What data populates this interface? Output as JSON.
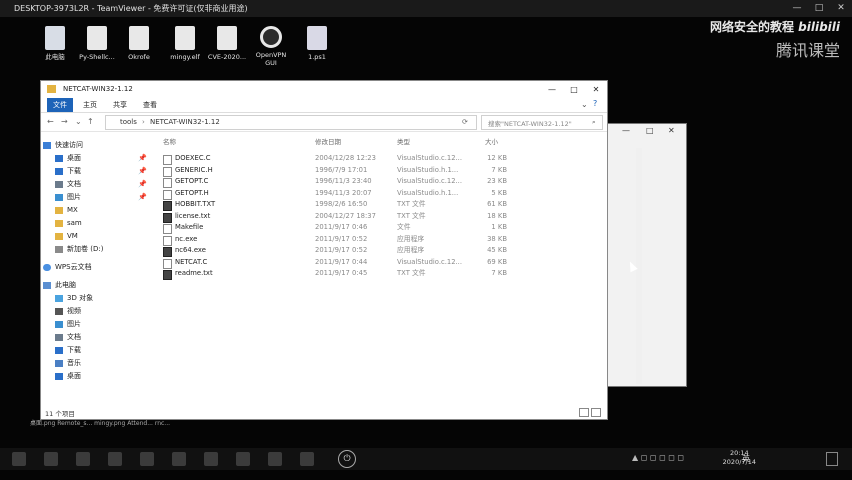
{
  "remote": {
    "title": "DESKTOP-3973L2R - TeamViewer - 免费许可证(仅非商业用途)",
    "controls": [
      "—",
      "□",
      "✕"
    ]
  },
  "desktop_icons": [
    {
      "label": "此电脑",
      "icon": "computer-icon"
    },
    {
      "label": "Py-Shellc...",
      "icon": "python-file-icon"
    },
    {
      "label": "Okrofe",
      "icon": "file-icon"
    },
    {
      "label": "mingy.elf",
      "icon": "file-icon"
    },
    {
      "label": "CVE-2020...",
      "icon": "file-icon"
    },
    {
      "label": "OpenVPN GUI",
      "icon": "openvpn-icon"
    },
    {
      "label": "1.ps1",
      "icon": "powershell-file-icon"
    }
  ],
  "watermark": {
    "text": "网络安全的教程",
    "logo": "bilibili",
    "brand": "腾讯课堂"
  },
  "explorer": {
    "title": "NETCAT-WIN32-1.12",
    "ribbon_tabs": [
      "文件",
      "主页",
      "共享",
      "查看"
    ],
    "breadcrumb": [
      "tools",
      "NETCAT-WIN32-1.12"
    ],
    "search_placeholder": "搜索\"NETCAT-WIN32-1.12\"",
    "columns": {
      "name": "名称",
      "date": "修改日期",
      "type": "类型",
      "size": "大小"
    },
    "sidebar": [
      {
        "label": "快速访问",
        "icon": "star-icon",
        "pinned": false
      },
      {
        "label": "桌面",
        "icon": "desktop-icon",
        "pinned": true
      },
      {
        "label": "下载",
        "icon": "download-icon",
        "pinned": true
      },
      {
        "label": "文档",
        "icon": "document-icon",
        "pinned": true
      },
      {
        "label": "图片",
        "icon": "picture-icon",
        "pinned": true
      },
      {
        "label": "MX",
        "icon": "folder-icon",
        "pinned": false
      },
      {
        "label": "sam",
        "icon": "folder-icon",
        "pinned": false
      },
      {
        "label": "VM",
        "icon": "folder-icon",
        "pinned": false
      },
      {
        "label": "新加卷 (D:)",
        "icon": "drive-icon",
        "pinned": false
      },
      {
        "label": "WPS云文档",
        "icon": "cloud-icon",
        "pinned": false
      },
      {
        "label": "此电脑",
        "icon": "computer-icon",
        "pinned": false
      },
      {
        "label": "3D 对象",
        "icon": "cube-icon",
        "pinned": false
      },
      {
        "label": "视频",
        "icon": "video-icon",
        "pinned": false
      },
      {
        "label": "图片",
        "icon": "picture-icon",
        "pinned": false
      },
      {
        "label": "文档",
        "icon": "document-icon",
        "pinned": false
      },
      {
        "label": "下载",
        "icon": "download-icon",
        "pinned": false
      },
      {
        "label": "音乐",
        "icon": "music-icon",
        "pinned": false
      },
      {
        "label": "桌面",
        "icon": "desktop-icon",
        "pinned": false
      }
    ],
    "files": [
      {
        "name": "DOEXEC.C",
        "date": "2004/12/28 12:23",
        "type": "VisualStudio.c.12...",
        "size": "12 KB",
        "dark": false
      },
      {
        "name": "GENERIC.H",
        "date": "1996/7/9 17:01",
        "type": "VisualStudio.h.1...",
        "size": "7 KB",
        "dark": false
      },
      {
        "name": "GETOPT.C",
        "date": "1996/11/3 23:40",
        "type": "VisualStudio.c.12...",
        "size": "23 KB",
        "dark": false
      },
      {
        "name": "GETOPT.H",
        "date": "1994/11/3 20:07",
        "type": "VisualStudio.h.1...",
        "size": "5 KB",
        "dark": false
      },
      {
        "name": "HOBBIT.TXT",
        "date": "1998/2/6 16:50",
        "type": "TXT 文件",
        "size": "61 KB",
        "dark": true
      },
      {
        "name": "license.txt",
        "date": "2004/12/27 18:37",
        "type": "TXT 文件",
        "size": "18 KB",
        "dark": true
      },
      {
        "name": "Makefile",
        "date": "2011/9/17 0:46",
        "type": "文件",
        "size": "1 KB",
        "dark": false
      },
      {
        "name": "nc.exe",
        "date": "2011/9/17 0:52",
        "type": "应用程序",
        "size": "38 KB",
        "dark": false
      },
      {
        "name": "nc64.exe",
        "date": "2011/9/17 0:52",
        "type": "应用程序",
        "size": "45 KB",
        "dark": false
      },
      {
        "name": "NETCAT.C",
        "date": "2011/9/17 0:44",
        "type": "VisualStudio.c.12...",
        "size": "69 KB",
        "dark": false
      },
      {
        "name": "readme.txt",
        "date": "2011/9/17 0:45",
        "type": "TXT 文件",
        "size": "7 KB",
        "dark": true
      }
    ],
    "status": "11 个项目"
  },
  "bottom_labels": "桌面.png  Remote_s...  mingy.png  Attend...  rnc...",
  "clock": {
    "time": "20:14",
    "date": "2020/7/14"
  },
  "ime": "英"
}
